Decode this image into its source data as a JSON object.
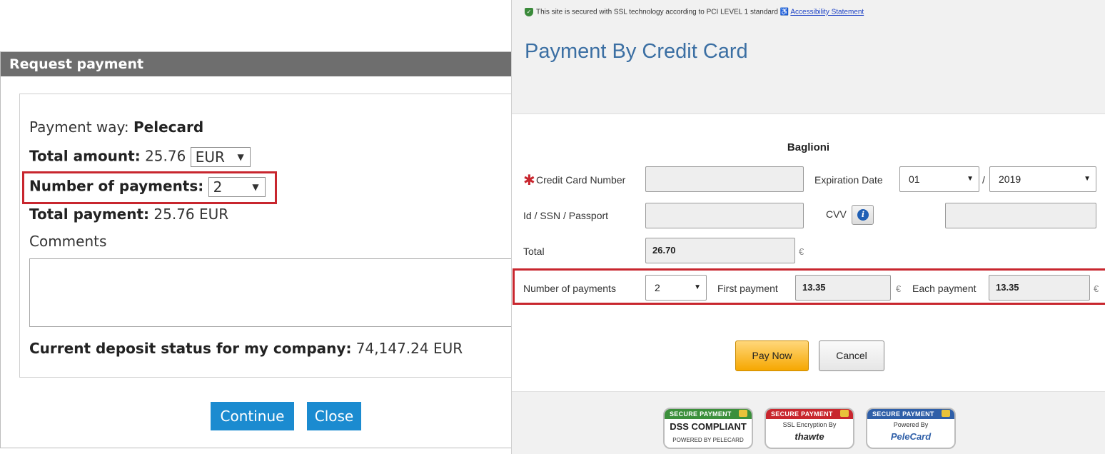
{
  "request_dialog": {
    "title": "Request payment",
    "payment_way_label": "Payment way: ",
    "payment_way_value": "Pelecard",
    "total_amount_label": "Total amount:",
    "total_amount_value": " 25.76 ",
    "currency_selected": "EUR",
    "num_payments_label": "Number of payments:",
    "num_payments_selected": "2",
    "total_payment_label": "Total payment:",
    "total_payment_value": " 25.76 EUR",
    "comments_label": "Comments",
    "deposit_label": "Current deposit status for my company:",
    "deposit_value": " 74,147.24 EUR",
    "continue_label": "Continue",
    "close_label": "Close"
  },
  "payment_panel": {
    "ssl_text": "This site is secured with SSL technology according to PCI LEVEL 1 standard",
    "accessibility_link": "Accessibility Statement",
    "title": "Payment By Credit Card",
    "merchant": "Baglioni",
    "card_number_label": "Credit Card Number",
    "expiration_label": "Expiration Date",
    "exp_month": "01",
    "exp_separator": "/",
    "exp_year": "2019",
    "id_label": "Id / SSN / Passport",
    "cvv_label": "CVV",
    "total_label": "Total",
    "total_value": "26.70",
    "currency_symbol": "€",
    "num_payments_label": "Number of payments",
    "num_payments_selected": "2",
    "first_payment_label": "First payment",
    "first_payment_value": "13.35",
    "each_payment_label": "Each payment",
    "each_payment_value": "13.35",
    "pay_now_label": "Pay Now",
    "cancel_label": "Cancel"
  },
  "badges": [
    {
      "header": "SECURE PAYMENT",
      "line1": "DSS COMPLIANT",
      "line2": "POWERED BY PELECARD",
      "color": "#3b8f3b"
    },
    {
      "header": "SECURE PAYMENT",
      "line1": "SSL Encryption By",
      "line2": "thawte",
      "color": "#c8262e"
    },
    {
      "header": "SECURE PAYMENT",
      "line1": "Powered By",
      "line2": "PeleCard",
      "color": "#2f5fa8"
    }
  ],
  "colors": {
    "dialog_header": "#6e6e6e",
    "button_blue": "#1b8bd0",
    "highlight_red": "#c8262e",
    "title_blue": "#3b6fa3",
    "pay_now_orange": "#f6a700"
  }
}
